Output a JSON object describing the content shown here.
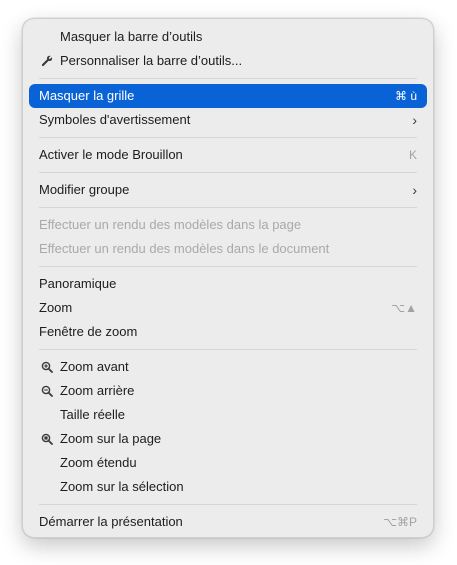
{
  "menu": {
    "items": [
      {
        "label": "Masquer la barre d’outils"
      },
      {
        "label": "Personnaliser la barre d’outils...",
        "icon": "wrench-icon"
      },
      {
        "label": "Masquer la grille",
        "shortcut": "⌘ ù"
      },
      {
        "label": "Symboles d'avertissement",
        "submenu": "›"
      },
      {
        "label": "Activer le mode Brouillon",
        "shortcut": "K"
      },
      {
        "label": "Modifier groupe",
        "submenu": "›"
      },
      {
        "label": "Effectuer un rendu des modèles dans la page"
      },
      {
        "label": "Effectuer un rendu des modèles dans le document"
      },
      {
        "label": "Panoramique"
      },
      {
        "label": "Zoom",
        "shortcut": "⌥▲"
      },
      {
        "label": "Fenêtre de zoom"
      },
      {
        "label": "Zoom avant",
        "icon": "zoom-in-icon"
      },
      {
        "label": "Zoom arrière",
        "icon": "zoom-out-icon"
      },
      {
        "label": "Taille réelle"
      },
      {
        "label": "Zoom sur la page",
        "icon": "zoom-page-icon"
      },
      {
        "label": "Zoom étendu"
      },
      {
        "label": "Zoom sur la sélection"
      },
      {
        "label": "Démarrer la présentation",
        "shortcut": "⌥⌘P"
      }
    ]
  },
  "colors": {
    "selected_bg": "#0a63d6",
    "menu_bg": "#ececec",
    "disabled_text": "#a9a9a9"
  }
}
